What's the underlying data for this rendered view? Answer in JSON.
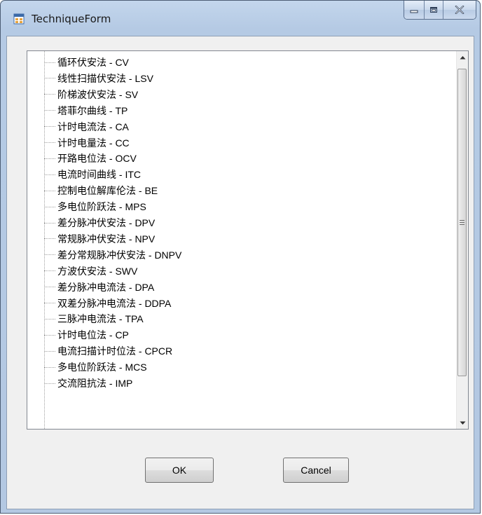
{
  "window": {
    "title": "TechniqueForm",
    "icon": "winforms-app-icon"
  },
  "title_controls": {
    "minimize_icon": "minimize-icon",
    "maximize_icon": "maximize-icon",
    "close_icon": "close-icon"
  },
  "tree": {
    "items": [
      {
        "label": "循环伏安法 - CV"
      },
      {
        "label": "线性扫描伏安法 - LSV"
      },
      {
        "label": "阶梯波伏安法 - SV"
      },
      {
        "label": "塔菲尔曲线 - TP"
      },
      {
        "label": "计时电流法 - CA"
      },
      {
        "label": "计时电量法 - CC"
      },
      {
        "label": "开路电位法 - OCV"
      },
      {
        "label": "电流时间曲线 - ITC"
      },
      {
        "label": "控制电位解库伦法 - BE"
      },
      {
        "label": "多电位阶跃法 - MPS"
      },
      {
        "label": "差分脉冲伏安法 - DPV"
      },
      {
        "label": "常规脉冲伏安法 - NPV"
      },
      {
        "label": "差分常规脉冲伏安法 - DNPV"
      },
      {
        "label": "方波伏安法 - SWV"
      },
      {
        "label": "差分脉冲电流法 - DPA"
      },
      {
        "label": "双差分脉冲电流法 - DDPA"
      },
      {
        "label": "三脉冲电流法 - TPA"
      },
      {
        "label": "计时电位法 - CP"
      },
      {
        "label": "电流扫描计时位法 - CPCR"
      },
      {
        "label": "多电位阶跃法 - MCS"
      },
      {
        "label": "交流阻抗法 - IMP"
      }
    ]
  },
  "buttons": {
    "ok_label": "OK",
    "cancel_label": "Cancel"
  },
  "colors": {
    "title_bar": "#b9cde6",
    "dialog_bg": "#f0f0f0",
    "list_bg": "#ffffff"
  }
}
